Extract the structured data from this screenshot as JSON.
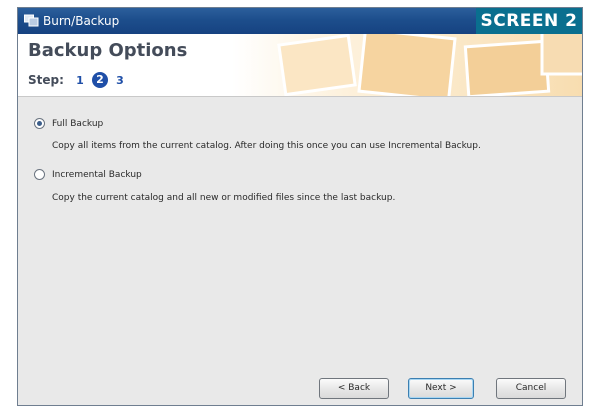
{
  "window": {
    "title": "Burn/Backup",
    "app_icon": "burn-backup-app-icon"
  },
  "badge": {
    "label": "SCREEN 2"
  },
  "header": {
    "title": "Backup Options",
    "steps_label": "Step:",
    "steps": [
      "1",
      "2",
      "3"
    ],
    "current_step": 2
  },
  "options": [
    {
      "label": "Full Backup",
      "description": "Copy all items from the current catalog. After doing this once you can use Incremental Backup.",
      "selected": true
    },
    {
      "label": "Incremental Backup",
      "description": "Copy the current catalog and all new or modified files since the last backup.",
      "selected": false
    }
  ],
  "buttons": {
    "back": "< Back",
    "next": "Next >",
    "cancel": "Cancel"
  },
  "colors": {
    "titlebar": "#1d4e8c",
    "badge": "#0a6f8f",
    "step_active": "#1f4fa8",
    "header_warm": "#f8ddb0"
  }
}
